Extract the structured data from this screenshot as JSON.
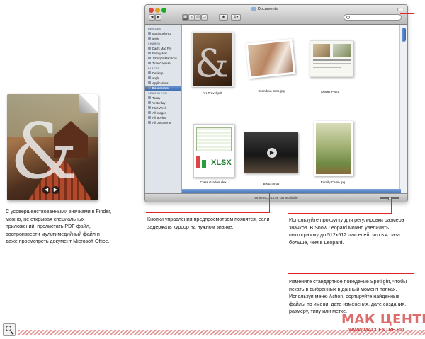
{
  "captions": {
    "left": "С усовершенствованными значками в Finder, можно, не открывая специальных приложений, пролистать PDF-файл, воспроизвести мультимедийный файл и даже просмотреть документ Microsoft Office.",
    "preview_buttons": "Кнопки управления предпросмотром появятся, если задержать курсор на нужном значке.",
    "icon_size": "Используйте прокрутку для регулировки размера значков. В Snow Leopard можно увеличить пиктограмму до 512x512 пикселей, что в 4 раза больше, чем в Leopard.",
    "spotlight": "Измените стандартное поведение Spotlight, чтобы искать в выбранных в данный момент папках. Используя меню Action, сортируйте найденные файлы по имени, дате изменения, дате создания, размеру, типу или метке."
  },
  "finder": {
    "title": "Documents",
    "sidebar": [
      {
        "type": "head",
        "label": "DEVICES"
      },
      {
        "type": "item",
        "label": "Macintosh HD"
      },
      {
        "type": "item",
        "label": "iDisk"
      },
      {
        "type": "head",
        "label": "SHARED"
      },
      {
        "type": "item",
        "label": "Dad's Mac Pro"
      },
      {
        "type": "item",
        "label": "Family Mac"
      },
      {
        "type": "item",
        "label": "Johnny's MacBook"
      },
      {
        "type": "item",
        "label": "Time Capsule"
      },
      {
        "type": "head",
        "label": "PLACES"
      },
      {
        "type": "item",
        "label": "Desktop"
      },
      {
        "type": "item",
        "label": "apple"
      },
      {
        "type": "item",
        "label": "Applications"
      },
      {
        "type": "item",
        "label": "Documents",
        "selected": true
      },
      {
        "type": "head",
        "label": "SEARCH FOR"
      },
      {
        "type": "item",
        "label": "Today"
      },
      {
        "type": "item",
        "label": "Yesterday"
      },
      {
        "type": "item",
        "label": "Past Week"
      },
      {
        "type": "item",
        "label": "All Images"
      },
      {
        "type": "item",
        "label": "All Movies"
      },
      {
        "type": "item",
        "label": "All Documents"
      }
    ],
    "files": [
      {
        "name": "AK Travel.pdf"
      },
      {
        "name": "Grandma Beth.jpg"
      },
      {
        "name": "Dinner Party"
      },
      {
        "name": "Class Grades.xlsx"
      },
      {
        "name": "Beach.mov"
      },
      {
        "name": "Family Cabin.jpg"
      }
    ],
    "status": "56 items, 213.58 GB available",
    "colors": {
      "accent": "#3f6fb3",
      "callout": "#e2232a"
    }
  },
  "watermark": {
    "brand": "МАК ЦЕНТР",
    "url": "WWW.MACCENTRE.RU"
  }
}
